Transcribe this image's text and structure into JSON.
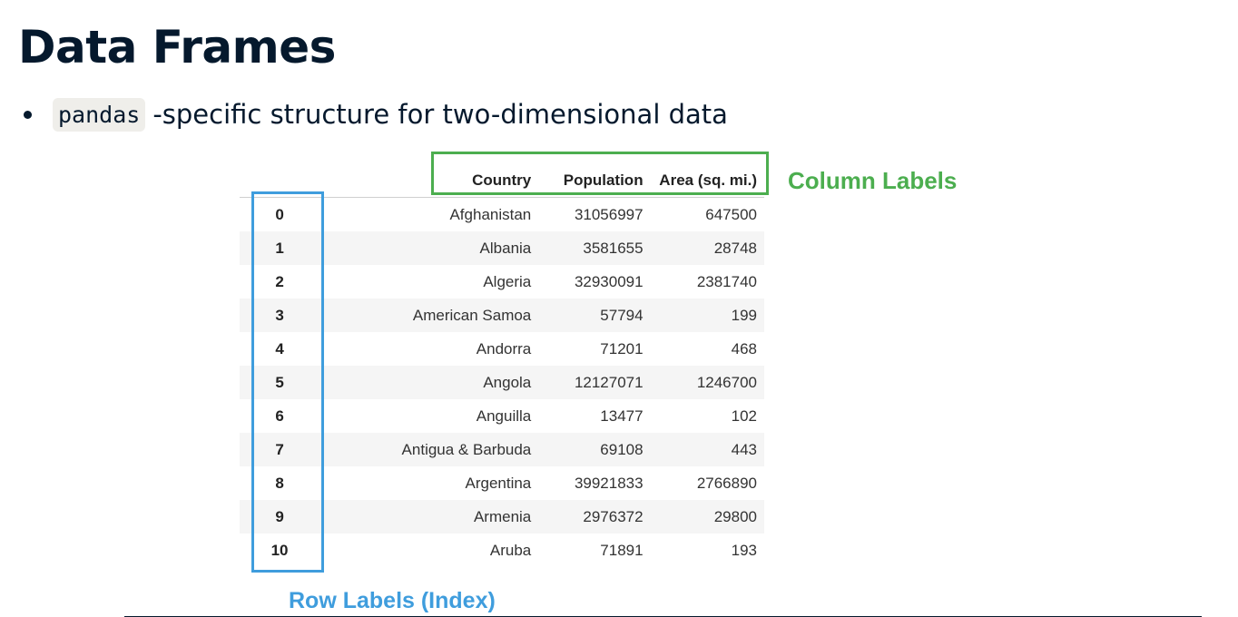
{
  "slide": {
    "title": "Data Frames",
    "bullet": {
      "code": "pandas",
      "text": "-specific structure for two-dimensional data"
    }
  },
  "table": {
    "columns": [
      "Country",
      "Population",
      "Area (sq. mi.)"
    ],
    "rows": [
      {
        "index": "0",
        "country": "Afghanistan",
        "population": "31056997",
        "area": "647500"
      },
      {
        "index": "1",
        "country": "Albania",
        "population": "3581655",
        "area": "28748"
      },
      {
        "index": "2",
        "country": "Algeria",
        "population": "32930091",
        "area": "2381740"
      },
      {
        "index": "3",
        "country": "American Samoa",
        "population": "57794",
        "area": "199"
      },
      {
        "index": "4",
        "country": "Andorra",
        "population": "71201",
        "area": "468"
      },
      {
        "index": "5",
        "country": "Angola",
        "population": "12127071",
        "area": "1246700"
      },
      {
        "index": "6",
        "country": "Anguilla",
        "population": "13477",
        "area": "102"
      },
      {
        "index": "7",
        "country": "Antigua & Barbuda",
        "population": "69108",
        "area": "443"
      },
      {
        "index": "8",
        "country": "Argentina",
        "population": "39921833",
        "area": "2766890"
      },
      {
        "index": "9",
        "country": "Armenia",
        "population": "2976372",
        "area": "29800"
      },
      {
        "index": "10",
        "country": "Aruba",
        "population": "71891",
        "area": "193"
      }
    ]
  },
  "annotations": {
    "column_labels": "Column Labels",
    "row_labels": "Row Labels (Index)",
    "column_color": "#4cae4f",
    "row_color": "#3f9ddd"
  }
}
